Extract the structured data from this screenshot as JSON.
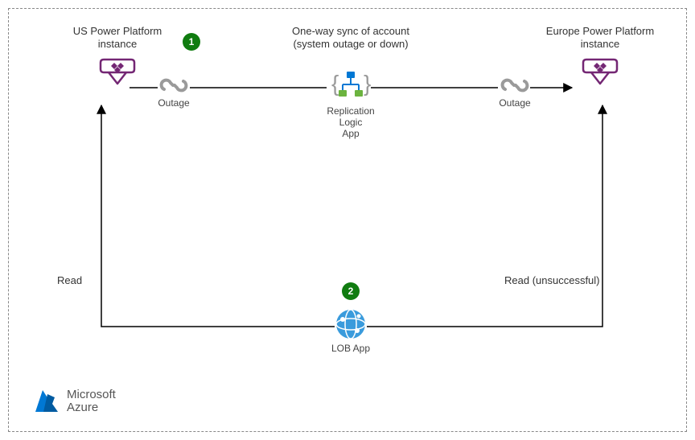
{
  "nodes": {
    "us_instance": {
      "title_l1": "US Power Platform",
      "title_l2": "instance"
    },
    "eu_instance": {
      "title_l1": "Europe Power Platform",
      "title_l2": "instance"
    },
    "sync_title": {
      "l1": "One-way sync of account",
      "l2": "(system outage or down)"
    },
    "replication_app": {
      "l1": "Replication Logic",
      "l2": "App"
    },
    "outage_left": "Outage",
    "outage_right": "Outage",
    "lob_app": "LOB App",
    "read_left": "Read",
    "read_right": "Read (unsuccessful)"
  },
  "badges": {
    "one": "1",
    "two": "2"
  },
  "branding": {
    "ms": "Microsoft",
    "azure": "Azure"
  },
  "colors": {
    "power_platform": "#742774",
    "link_broken": "#9a9a9a",
    "logic_app_frame": "#9a9a9a",
    "logic_app_blue": "#0078d4",
    "logic_app_green": "#6cb33f",
    "lob_app": "#3a9bdc",
    "badge": "#107c10",
    "azure_blue": "#0078d4",
    "line": "#000"
  }
}
